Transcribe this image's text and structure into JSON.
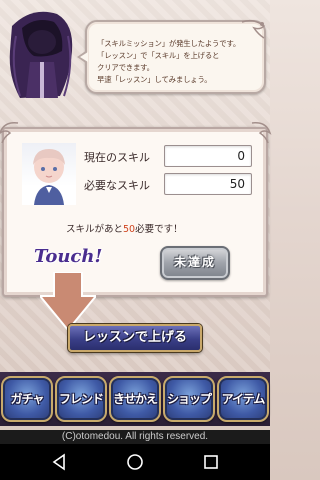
{
  "speech": {
    "lines": [
      "「スキルミッション」が発生したようです。",
      "「レッスン」で「スキル」を上げると",
      "クリアできます。",
      "早速「レッスン」してみましょう。"
    ]
  },
  "skill": {
    "current_label": "現在のスキル",
    "current_value": "0",
    "required_label": "必要なスキル",
    "required_value": "50",
    "need_prefix": "スキルがあと",
    "need_value": "50",
    "need_suffix": "必要です！"
  },
  "status_button": "未達成",
  "touch_hint": "Touch!",
  "levelup_button": "レッスンで上げる",
  "nav": {
    "items": [
      {
        "label": "ガチャ",
        "icon": "gacha-icon"
      },
      {
        "label": "フレンド",
        "icon": "friend-icon"
      },
      {
        "label": "きせかえ",
        "icon": "dressup-icon"
      },
      {
        "label": "ショップ",
        "icon": "shop-icon"
      },
      {
        "label": "アイテム",
        "icon": "item-icon"
      }
    ]
  },
  "copyright": "(C)otomedou. All rights reserved.",
  "colors": {
    "accent_text": "#d0441f",
    "touch": "#4a2d8f",
    "button_blue": "#3a3f88"
  }
}
